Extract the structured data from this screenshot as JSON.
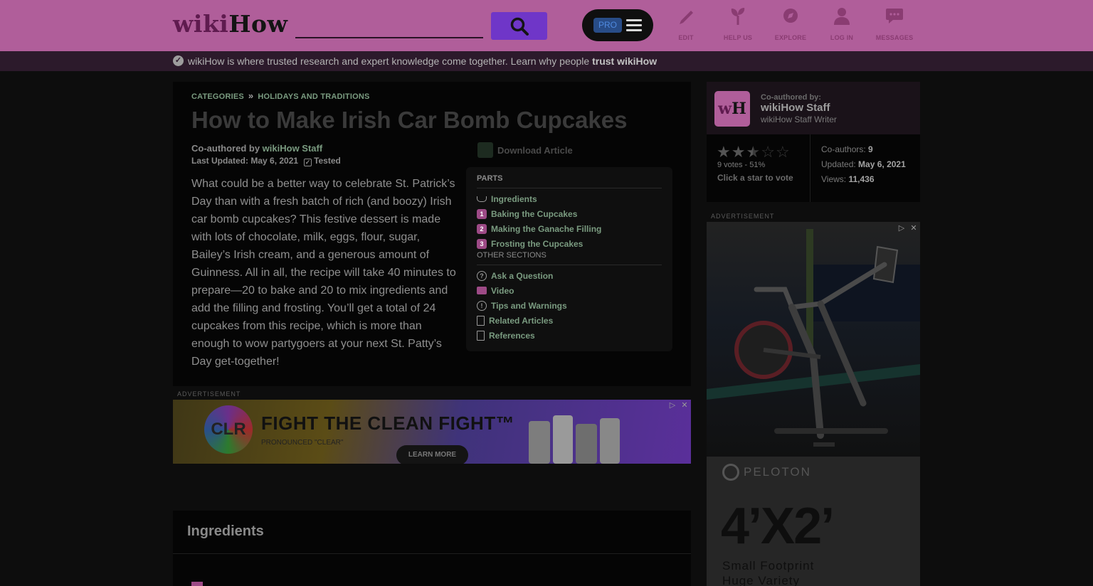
{
  "header": {
    "logo_wiki": "wiki",
    "logo_how": "How",
    "search_placeholder": "",
    "pro_label": "PRO",
    "nav": [
      {
        "label": "EDIT",
        "icon": "pencil-icon"
      },
      {
        "label": "HELP US",
        "icon": "sprout-icon"
      },
      {
        "label": "EXPLORE",
        "icon": "compass-icon"
      },
      {
        "label": "LOG IN",
        "icon": "user-icon"
      },
      {
        "label": "MESSAGES",
        "icon": "chat-icon"
      }
    ]
  },
  "trust_banner": {
    "text": "wikiHow is where trusted research and expert knowledge come together. Learn why people ",
    "link": "trust wikiHow"
  },
  "article": {
    "breadcrumb": [
      "CATEGORIES",
      "HOLIDAYS AND TRADITIONS"
    ],
    "breadcrumb_sep": "»",
    "title": "How to Make Irish Car Bomb Cupcakes",
    "coauthored_prefix": "Co-authored by ",
    "coauthor": "wikiHow Staff",
    "last_updated": "Last Updated: May 6, 2021",
    "tested": "Tested",
    "intro": "What could be a better way to celebrate St. Patrick’s Day than with a fresh batch of rich (and boozy) Irish car bomb cupcakes? This festive dessert is made with lots of chocolate, milk, eggs, flour, sugar, Bailey’s Irish cream, and a generous amount of Guinness. All in all, the recipe will take 40 minutes to prepare—20 to bake and 20 to mix ingredients and add the filling and frosting. You’ll get a total of 24 cupcakes from this recipe, which is more than enough to wow partygoers at your next St. Patty’s Day get-together!",
    "download": "Download Article"
  },
  "toc": {
    "parts_heading": "PARTS",
    "parts": [
      {
        "marker": "",
        "label": "Ingredients"
      },
      {
        "marker": "1",
        "label": "Baking the Cupcakes"
      },
      {
        "marker": "2",
        "label": "Making the Ganache Filling"
      },
      {
        "marker": "3",
        "label": "Frosting the Cupcakes"
      }
    ],
    "other_heading": "OTHER SECTIONS",
    "other": [
      {
        "marker": "?",
        "label": "Ask a Question"
      },
      {
        "marker": "",
        "label": "Video"
      },
      {
        "marker": "!",
        "label": "Tips and Warnings"
      },
      {
        "marker": "",
        "label": "Related Articles"
      },
      {
        "marker": "",
        "label": "References"
      }
    ]
  },
  "ads": {
    "label": "ADVERTISEMENT",
    "banner_logo": "CLR",
    "banner_headline": "FIGHT THE CLEAN FIGHT™",
    "banner_sub": "PRONOUNCED \"CLEAR\"",
    "banner_button": "LEARN MORE",
    "side_brand": "PELOTON",
    "side_size": "4’X2’",
    "side_line1": "Small Footprint",
    "side_line2": "Huge Variety"
  },
  "ingredients": {
    "heading": "Ingredients"
  },
  "sidebar": {
    "coauthored_label": "Co-authored by:",
    "author_name": "wikiHow Staff",
    "author_role": "wikiHow Staff Writer",
    "avatar_w": "w",
    "avatar_h": "H",
    "rating_fraction": 0.51,
    "votes": "9 votes - 51%",
    "vote_call": "Click a star to vote",
    "coauthors_label": "Co-authors: ",
    "coauthors": "9",
    "updated_label": "Updated: ",
    "updated": "May 6, 2021",
    "views_label": "Views: ",
    "views": "11,436"
  },
  "colors": {
    "header_bg": "#b05e9a",
    "search_button": "#6f36c8",
    "link_green": "#7a9b80",
    "accent_magenta": "#9d4a86"
  }
}
